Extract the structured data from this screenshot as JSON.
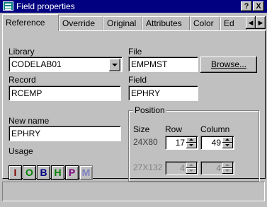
{
  "window": {
    "title": "Field properties",
    "help_btn": "?",
    "close_btn": "X"
  },
  "tabs": [
    "Reference",
    "Override",
    "Original",
    "Attributes",
    "Color",
    "Ed"
  ],
  "library": {
    "label": "Library",
    "value": "CODELAB01"
  },
  "file": {
    "label": "File",
    "value": "EMPMST"
  },
  "browse_label": "Browse...",
  "record": {
    "label": "Record",
    "value": "RCEMP"
  },
  "field": {
    "label": "Field",
    "value": "EPHRY"
  },
  "new_name": {
    "label": "New name",
    "value": "EPHRY"
  },
  "position": {
    "title": "Position",
    "size_header": "Size",
    "row_header": "Row",
    "column_header": "Column",
    "size1": "24X80",
    "row1": "17",
    "col1": "49",
    "size2": "27X132",
    "row2": "4",
    "col2": "4"
  },
  "usage": {
    "label": "Usage",
    "buttons": [
      "I",
      "O",
      "B",
      "H",
      "P",
      "M"
    ],
    "colors": {
      "I": "#800000",
      "O": "#008000",
      "B": "#000080",
      "H": "#008000",
      "P": "#800080",
      "M": "#8080c0"
    }
  },
  "status_text": ""
}
